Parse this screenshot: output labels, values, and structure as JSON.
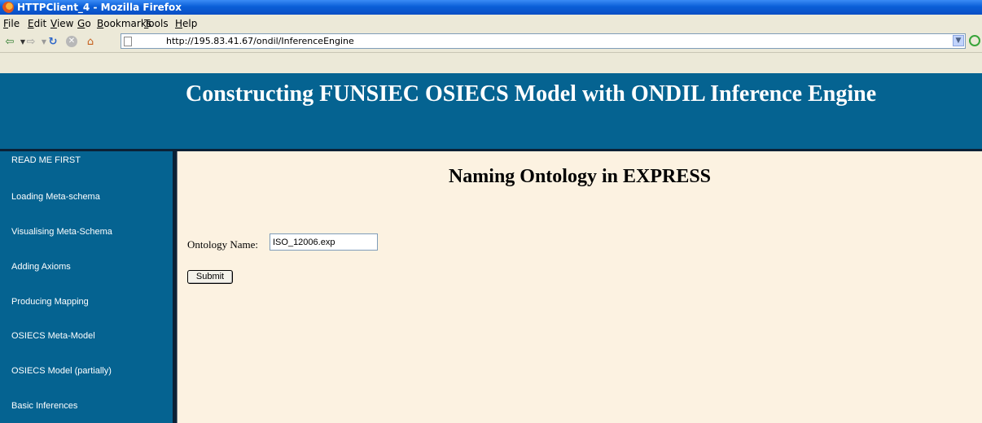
{
  "window": {
    "title": "HTTPClient_4 - Mozilla Firefox"
  },
  "menu": {
    "items": [
      "File",
      "Edit",
      "View",
      "Go",
      "Bookmarks",
      "Tools",
      "Help"
    ]
  },
  "toolbar": {
    "url": "http://195.83.41.67/ondil/InferenceEngine",
    "icons": [
      "back-icon",
      "forward-icon",
      "reload-icon",
      "stop-icon",
      "home-icon",
      "page-icon",
      "url-dropdown-icon",
      "go-icon"
    ]
  },
  "header": {
    "title": "Constructing FUNSIEC OSIECS Model with ONDIL Inference Engine"
  },
  "sidebar": {
    "items": [
      {
        "label": "READ ME FIRST"
      },
      {
        "label": "Loading Meta-schema"
      },
      {
        "label": "Visualising Meta-Schema"
      },
      {
        "label": "Adding Axioms"
      },
      {
        "label": "Producing Mapping"
      },
      {
        "label": "OSIECS Meta-Model"
      },
      {
        "label": "OSIECS Model (partially)"
      },
      {
        "label": "Basic Inferences"
      }
    ]
  },
  "main": {
    "heading": "Naming Ontology in EXPRESS",
    "form": {
      "label": "Ontology Name:",
      "value": "ISO_12006.exp",
      "submit_label": "Submit"
    }
  },
  "colors": {
    "header_bg": "#056391",
    "content_bg": "#fcf2e1",
    "title_bar": "#0a5fd8"
  }
}
